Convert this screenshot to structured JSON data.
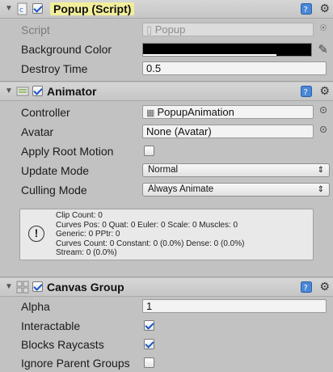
{
  "popup": {
    "title": "Popup (Script)",
    "script_label": "Script",
    "script_value": "Popup",
    "bg_color_label": "Background Color",
    "destroy_time_label": "Destroy Time",
    "destroy_time_value": "0.5"
  },
  "animator": {
    "title": "Animator",
    "controller_label": "Controller",
    "controller_value": "PopupAnimation",
    "avatar_label": "Avatar",
    "avatar_value": "None (Avatar)",
    "apply_root_motion_label": "Apply Root Motion",
    "update_mode_label": "Update Mode",
    "update_mode_value": "Normal",
    "culling_mode_label": "Culling Mode",
    "culling_mode_value": "Always Animate",
    "info_lines": [
      "Clip Count: 0",
      "Curves Pos: 0 Quat: 0 Euler: 0 Scale: 0 Muscles: 0",
      "Generic: 0 PPtr: 0",
      "Curves Count: 0 Constant: 0 (0.0%) Dense: 0 (0.0%)",
      "Stream: 0 (0.0%)"
    ]
  },
  "canvas_group": {
    "title": "Canvas Group",
    "alpha_label": "Alpha",
    "alpha_value": "1",
    "interactable_label": "Interactable",
    "blocks_raycasts_label": "Blocks Raycasts",
    "ignore_parent_label": "Ignore Parent Groups"
  },
  "colors": {
    "background_color_swatch": "#000000",
    "title_highlight": "#f2ef9a",
    "check_blue": "#1b56c9"
  }
}
